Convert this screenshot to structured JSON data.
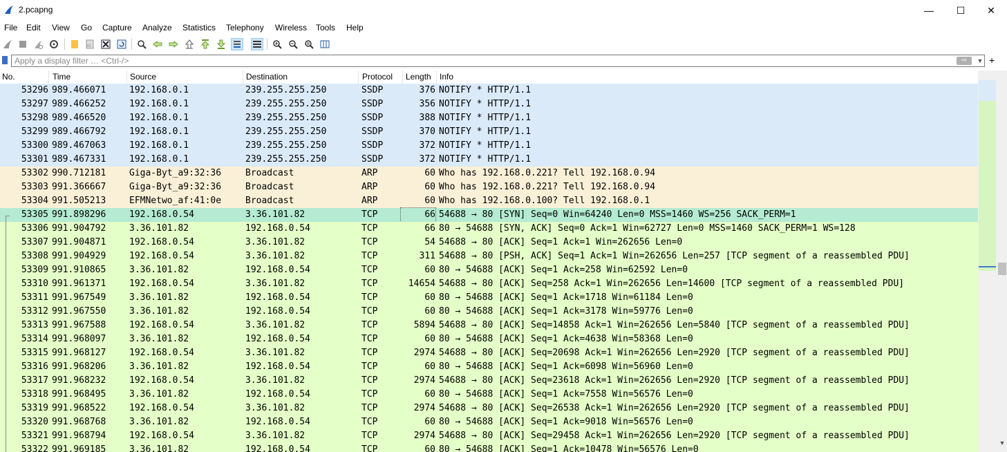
{
  "window": {
    "title": "2.pcapng",
    "min_glyph": "—",
    "max_glyph": "☐",
    "close_glyph": "✕"
  },
  "menu": [
    "File",
    "Edit",
    "View",
    "Go",
    "Capture",
    "Analyze",
    "Statistics",
    "Telephony",
    "Wireless",
    "Tools",
    "Help"
  ],
  "toolbar_icons": [
    "shark-start-icon",
    "stop-icon",
    "restart-icon",
    "options-gear-icon",
    "open-file-icon",
    "save-file-icon",
    "close-file-icon",
    "reload-icon",
    "search-icon",
    "go-back-icon",
    "go-forward-icon",
    "go-to-first-icon",
    "go-to-last-icon",
    "autoscroll-icon",
    "colorize-icon",
    "zoom-in-icon",
    "zoom-out-icon",
    "normal-size-icon",
    "resize-columns-icon"
  ],
  "filter": {
    "placeholder": "Apply a display filter … <Ctrl-/>",
    "arrow_glyph": "⇨",
    "dropdown_glyph": "▼",
    "plus_glyph": "+"
  },
  "columns": {
    "no": "No.",
    "time": "Time",
    "source": "Source",
    "destination": "Destination",
    "protocol": "Protocol",
    "length": "Length",
    "info": "Info"
  },
  "colors": {
    "ssdp_bg": "#daeaf9",
    "arp_bg": "#faf0d7",
    "tcp_bg": "#e4ffc7",
    "selected_bg": "#b4ebd2"
  },
  "packets": [
    {
      "no": "53296",
      "time": "989.466071",
      "src": "192.168.0.1",
      "dst": "239.255.255.250",
      "proto": "SSDP",
      "len": "376",
      "info": "NOTIFY * HTTP/1.1",
      "kind": "ssdp"
    },
    {
      "no": "53297",
      "time": "989.466252",
      "src": "192.168.0.1",
      "dst": "239.255.255.250",
      "proto": "SSDP",
      "len": "356",
      "info": "NOTIFY * HTTP/1.1",
      "kind": "ssdp"
    },
    {
      "no": "53298",
      "time": "989.466520",
      "src": "192.168.0.1",
      "dst": "239.255.255.250",
      "proto": "SSDP",
      "len": "388",
      "info": "NOTIFY * HTTP/1.1",
      "kind": "ssdp"
    },
    {
      "no": "53299",
      "time": "989.466792",
      "src": "192.168.0.1",
      "dst": "239.255.255.250",
      "proto": "SSDP",
      "len": "370",
      "info": "NOTIFY * HTTP/1.1",
      "kind": "ssdp"
    },
    {
      "no": "53300",
      "time": "989.467063",
      "src": "192.168.0.1",
      "dst": "239.255.255.250",
      "proto": "SSDP",
      "len": "372",
      "info": "NOTIFY * HTTP/1.1",
      "kind": "ssdp"
    },
    {
      "no": "53301",
      "time": "989.467331",
      "src": "192.168.0.1",
      "dst": "239.255.255.250",
      "proto": "SSDP",
      "len": "372",
      "info": "NOTIFY * HTTP/1.1",
      "kind": "ssdp"
    },
    {
      "no": "53302",
      "time": "990.712181",
      "src": "Giga-Byt_a9:32:36",
      "dst": "Broadcast",
      "proto": "ARP",
      "len": "60",
      "info": "Who has 192.168.0.221? Tell 192.168.0.94",
      "kind": "arp"
    },
    {
      "no": "53303",
      "time": "991.366667",
      "src": "Giga-Byt_a9:32:36",
      "dst": "Broadcast",
      "proto": "ARP",
      "len": "60",
      "info": "Who has 192.168.0.221? Tell 192.168.0.94",
      "kind": "arp"
    },
    {
      "no": "53304",
      "time": "991.505213",
      "src": "EFMNetwo_af:41:0e",
      "dst": "Broadcast",
      "proto": "ARP",
      "len": "60",
      "info": "Who has 192.168.0.100? Tell 192.168.0.1",
      "kind": "arp"
    },
    {
      "no": "53305",
      "time": "991.898296",
      "src": "192.168.0.54",
      "dst": "3.36.101.82",
      "proto": "TCP",
      "len": "66",
      "info": "54688 → 80 [SYN] Seq=0 Win=64240 Len=0 MSS=1460 WS=256 SACK_PERM=1",
      "kind": "selected"
    },
    {
      "no": "53306",
      "time": "991.904792",
      "src": "3.36.101.82",
      "dst": "192.168.0.54",
      "proto": "TCP",
      "len": "66",
      "info": "80 → 54688 [SYN, ACK] Seq=0 Ack=1 Win=62727 Len=0 MSS=1460 SACK_PERM=1 WS=128",
      "kind": "tcp"
    },
    {
      "no": "53307",
      "time": "991.904871",
      "src": "192.168.0.54",
      "dst": "3.36.101.82",
      "proto": "TCP",
      "len": "54",
      "info": "54688 → 80 [ACK] Seq=1 Ack=1 Win=262656 Len=0",
      "kind": "tcp"
    },
    {
      "no": "53308",
      "time": "991.904929",
      "src": "192.168.0.54",
      "dst": "3.36.101.82",
      "proto": "TCP",
      "len": "311",
      "info": "54688 → 80 [PSH, ACK] Seq=1 Ack=1 Win=262656 Len=257 [TCP segment of a reassembled PDU]",
      "kind": "tcp"
    },
    {
      "no": "53309",
      "time": "991.910865",
      "src": "3.36.101.82",
      "dst": "192.168.0.54",
      "proto": "TCP",
      "len": "60",
      "info": "80 → 54688 [ACK] Seq=1 Ack=258 Win=62592 Len=0",
      "kind": "tcp"
    },
    {
      "no": "53310",
      "time": "991.961371",
      "src": "192.168.0.54",
      "dst": "3.36.101.82",
      "proto": "TCP",
      "len": "14654",
      "info": "54688 → 80 [ACK] Seq=258 Ack=1 Win=262656 Len=14600 [TCP segment of a reassembled PDU]",
      "kind": "tcp"
    },
    {
      "no": "53311",
      "time": "991.967549",
      "src": "3.36.101.82",
      "dst": "192.168.0.54",
      "proto": "TCP",
      "len": "60",
      "info": "80 → 54688 [ACK] Seq=1 Ack=1718 Win=61184 Len=0",
      "kind": "tcp"
    },
    {
      "no": "53312",
      "time": "991.967550",
      "src": "3.36.101.82",
      "dst": "192.168.0.54",
      "proto": "TCP",
      "len": "60",
      "info": "80 → 54688 [ACK] Seq=1 Ack=3178 Win=59776 Len=0",
      "kind": "tcp"
    },
    {
      "no": "53313",
      "time": "991.967588",
      "src": "192.168.0.54",
      "dst": "3.36.101.82",
      "proto": "TCP",
      "len": "5894",
      "info": "54688 → 80 [ACK] Seq=14858 Ack=1 Win=262656 Len=5840 [TCP segment of a reassembled PDU]",
      "kind": "tcp"
    },
    {
      "no": "53314",
      "time": "991.968097",
      "src": "3.36.101.82",
      "dst": "192.168.0.54",
      "proto": "TCP",
      "len": "60",
      "info": "80 → 54688 [ACK] Seq=1 Ack=4638 Win=58368 Len=0",
      "kind": "tcp"
    },
    {
      "no": "53315",
      "time": "991.968127",
      "src": "192.168.0.54",
      "dst": "3.36.101.82",
      "proto": "TCP",
      "len": "2974",
      "info": "54688 → 80 [ACK] Seq=20698 Ack=1 Win=262656 Len=2920 [TCP segment of a reassembled PDU]",
      "kind": "tcp"
    },
    {
      "no": "53316",
      "time": "991.968206",
      "src": "3.36.101.82",
      "dst": "192.168.0.54",
      "proto": "TCP",
      "len": "60",
      "info": "80 → 54688 [ACK] Seq=1 Ack=6098 Win=56960 Len=0",
      "kind": "tcp"
    },
    {
      "no": "53317",
      "time": "991.968232",
      "src": "192.168.0.54",
      "dst": "3.36.101.82",
      "proto": "TCP",
      "len": "2974",
      "info": "54688 → 80 [ACK] Seq=23618 Ack=1 Win=262656 Len=2920 [TCP segment of a reassembled PDU]",
      "kind": "tcp"
    },
    {
      "no": "53318",
      "time": "991.968495",
      "src": "3.36.101.82",
      "dst": "192.168.0.54",
      "proto": "TCP",
      "len": "60",
      "info": "80 → 54688 [ACK] Seq=1 Ack=7558 Win=56576 Len=0",
      "kind": "tcp"
    },
    {
      "no": "53319",
      "time": "991.968522",
      "src": "192.168.0.54",
      "dst": "3.36.101.82",
      "proto": "TCP",
      "len": "2974",
      "info": "54688 → 80 [ACK] Seq=26538 Ack=1 Win=262656 Len=2920 [TCP segment of a reassembled PDU]",
      "kind": "tcp"
    },
    {
      "no": "53320",
      "time": "991.968768",
      "src": "3.36.101.82",
      "dst": "192.168.0.54",
      "proto": "TCP",
      "len": "60",
      "info": "80 → 54688 [ACK] Seq=1 Ack=9018 Win=56576 Len=0",
      "kind": "tcp"
    },
    {
      "no": "53321",
      "time": "991.968794",
      "src": "192.168.0.54",
      "dst": "3.36.101.82",
      "proto": "TCP",
      "len": "2974",
      "info": "54688 → 80 [ACK] Seq=29458 Ack=1 Win=262656 Len=2920 [TCP segment of a reassembled PDU]",
      "kind": "tcp"
    },
    {
      "no": "53322",
      "time": "991.969185",
      "src": "3.36.101.82",
      "dst": "192.168.0.54",
      "proto": "TCP",
      "len": "60",
      "info": "80 → 54688 [ACK] Seq=1 Ack=10478 Win=56576 Len=0",
      "kind": "tcp"
    }
  ]
}
